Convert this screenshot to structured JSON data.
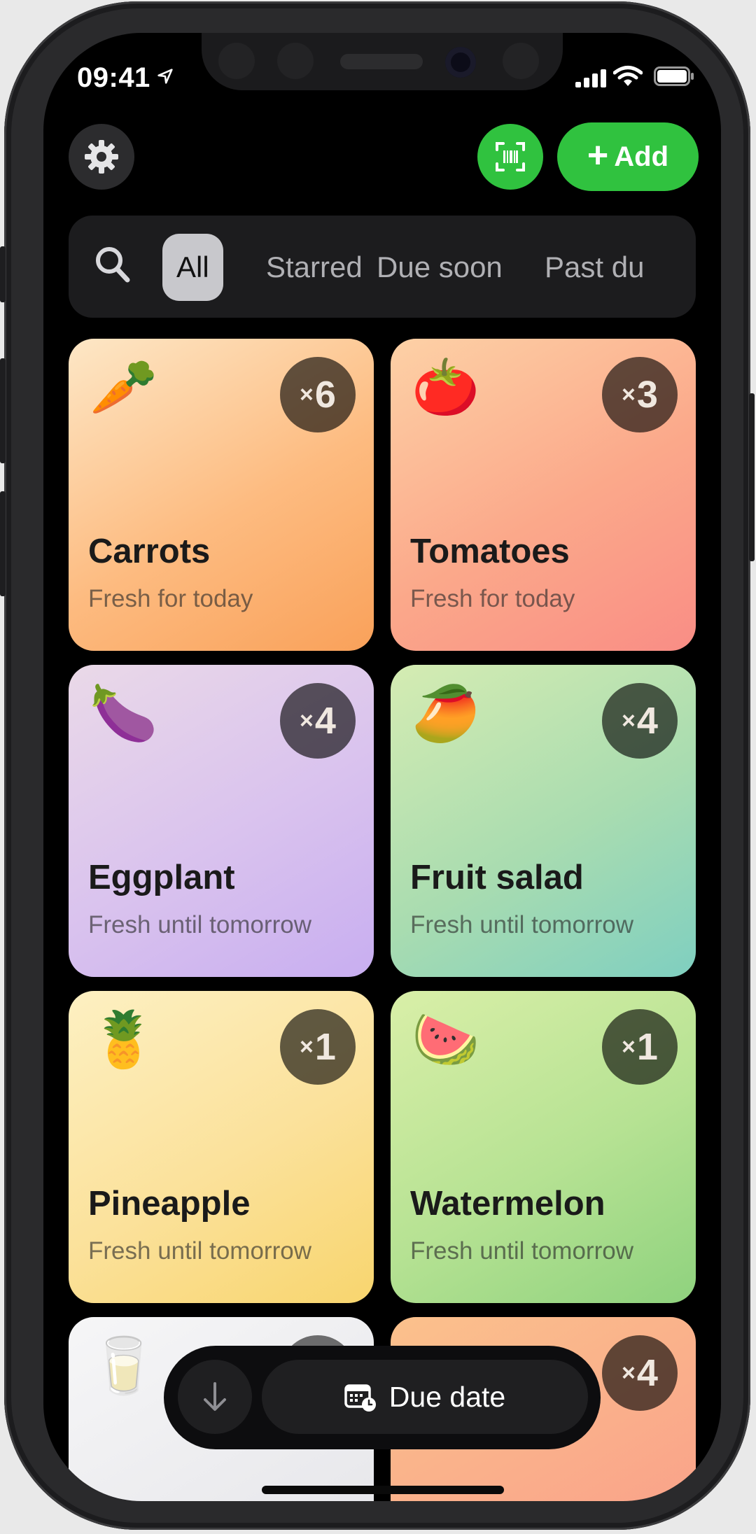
{
  "status": {
    "time": "09:41"
  },
  "header": {
    "add_label": "Add"
  },
  "filters": [
    {
      "label": "All",
      "active": true
    },
    {
      "label": "Starred",
      "active": false
    },
    {
      "label": "Due soon",
      "active": false
    },
    {
      "label": "Past du",
      "active": false
    }
  ],
  "items": [
    {
      "emoji": "🥕",
      "name": "Carrots",
      "subtitle": "Fresh for today",
      "count": "6"
    },
    {
      "emoji": "🍅",
      "name": "Tomatoes",
      "subtitle": "Fresh for today",
      "count": "3"
    },
    {
      "emoji": "🍆",
      "name": "Eggplant",
      "subtitle": "Fresh until tomorrow",
      "count": "4"
    },
    {
      "emoji": "🥭",
      "name": "Fruit salad",
      "subtitle": "Fresh until tomorrow",
      "count": "4"
    },
    {
      "emoji": "🍍",
      "name": "Pineapple",
      "subtitle": "Fresh until tomorrow",
      "count": "1"
    },
    {
      "emoji": "🍉",
      "name": "Watermelon",
      "subtitle": "Fresh until tomorrow",
      "count": "1"
    },
    {
      "emoji": "🥛",
      "count": ""
    },
    {
      "count": "4"
    }
  ],
  "count_prefix": "×",
  "sort": {
    "label": "Due date"
  },
  "colors": {
    "accent_green": "#30c23f"
  },
  "icons": {
    "settings": "gear-icon",
    "scan": "barcode-scan-icon",
    "add": "plus-icon",
    "search": "search-icon",
    "sort_direction": "arrow-down-icon",
    "sort_type": "calendar-clock-icon"
  }
}
